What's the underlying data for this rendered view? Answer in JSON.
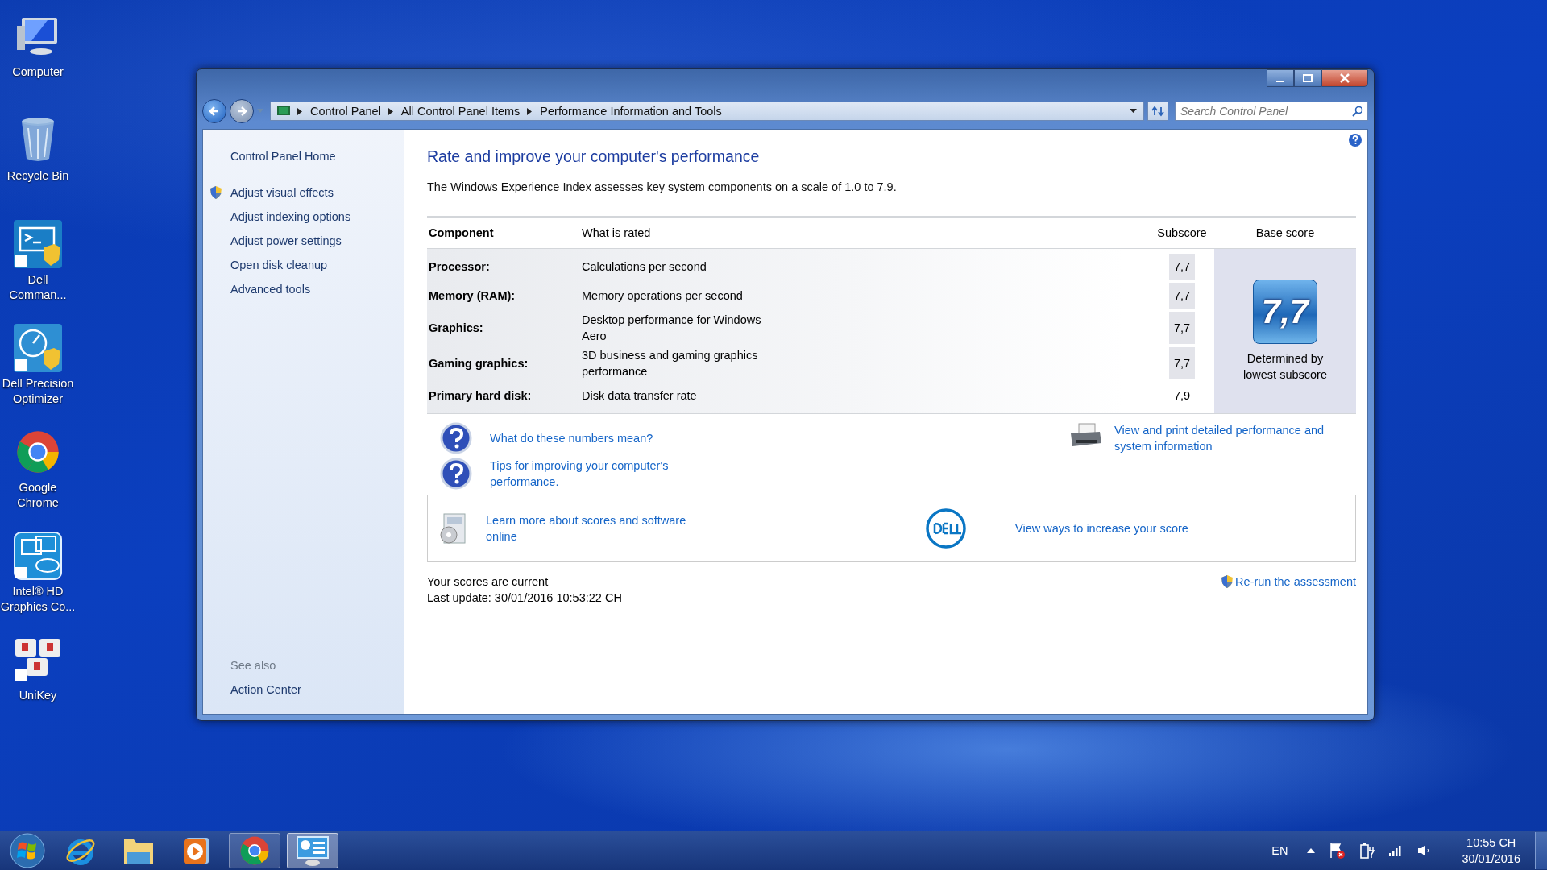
{
  "desktop_icons": [
    {
      "label": "Computer",
      "kind": "computer"
    },
    {
      "label": "Recycle Bin",
      "kind": "recycle"
    },
    {
      "label": "Dell Comman...",
      "kind": "terminal"
    },
    {
      "label": "Dell Precision Optimizer",
      "kind": "gauge"
    },
    {
      "label": "Google Chrome",
      "kind": "chrome"
    },
    {
      "label": "Intel® HD Graphics Co...",
      "kind": "intel"
    },
    {
      "label": "UniKey",
      "kind": "keys"
    }
  ],
  "window": {
    "breadcrumb": [
      "Control Panel",
      "All Control Panel Items",
      "Performance Information and Tools"
    ],
    "search": {
      "placeholder": "Search Control Panel"
    }
  },
  "sidebar": {
    "items": [
      {
        "label": "Control Panel Home",
        "kind": "plain"
      },
      {
        "label": "Adjust visual effects",
        "kind": "shield"
      },
      {
        "label": "Adjust indexing options",
        "kind": "plain"
      },
      {
        "label": "Adjust power settings",
        "kind": "plain"
      },
      {
        "label": "Open disk cleanup",
        "kind": "plain"
      },
      {
        "label": "Advanced tools",
        "kind": "plain"
      }
    ],
    "see_also": {
      "heading": "See also",
      "items": [
        "Action Center"
      ]
    }
  },
  "content": {
    "heading": "Rate and improve your computer's performance",
    "intro": "The Windows Experience Index assesses key system components on a scale of 1.0 to 7.9.",
    "table": {
      "columns": [
        "Component",
        "What is rated",
        "Subscore",
        "Base score"
      ],
      "rows": [
        {
          "component": "Processor:",
          "rated": "Calculations per second",
          "subscore": "7,7",
          "lowest": true
        },
        {
          "component": "Memory (RAM):",
          "rated": "Memory operations per second",
          "subscore": "7,7",
          "lowest": true
        },
        {
          "component": "Graphics:",
          "rated": "Desktop performance for Windows Aero",
          "subscore": "7,7",
          "lowest": true
        },
        {
          "component": "Gaming graphics:",
          "rated": "3D business and gaming graphics performance",
          "subscore": "7,7",
          "lowest": true
        },
        {
          "component": "Primary hard disk:",
          "rated": "Disk data transfer rate",
          "subscore": "7,9",
          "lowest": false
        }
      ]
    },
    "base_score": {
      "value": "7,7",
      "caption": "Determined by lowest subscore"
    },
    "help_links": [
      "What do these numbers mean?",
      "Tips for improving your computer's performance."
    ],
    "print_link": "View and print detailed performance and system information",
    "info_box": {
      "learn_link": "Learn more about scores and software online",
      "dell_link": "View ways to increase your score"
    },
    "status": [
      "Your scores are current",
      "Last update: 30/01/2016 10:53:22 CH"
    ],
    "rerun_link": "Re-run the assessment"
  },
  "taskbar": {
    "apps": [
      {
        "kind": "start",
        "running": false,
        "selected": false
      },
      {
        "kind": "ie",
        "running": false,
        "selected": false
      },
      {
        "kind": "folder",
        "running": false,
        "selected": false
      },
      {
        "kind": "media",
        "running": false,
        "selected": false
      },
      {
        "kind": "chrome",
        "running": true,
        "selected": false
      },
      {
        "kind": "control",
        "running": true,
        "selected": true
      }
    ],
    "tray": {
      "language": "EN",
      "time": "10:55 CH",
      "date": "30/01/2016"
    }
  }
}
